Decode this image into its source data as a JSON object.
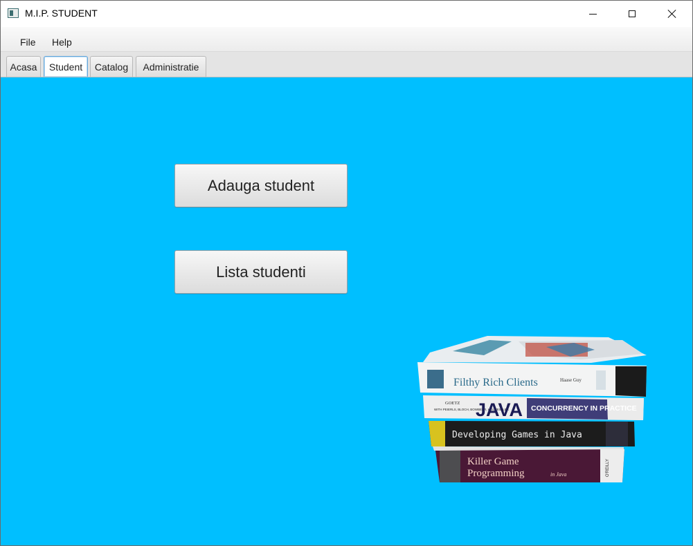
{
  "window": {
    "title": "M.I.P. STUDENT"
  },
  "menu": {
    "items": [
      "File",
      "Help"
    ]
  },
  "tabs": [
    {
      "label": "Acasa",
      "active": false
    },
    {
      "label": "Student",
      "active": true
    },
    {
      "label": "Catalog",
      "active": false
    },
    {
      "label": "Administratie",
      "active": false
    }
  ],
  "content": {
    "background": "#00bfff",
    "buttons": {
      "add_student": "Adauga student",
      "list_students": "Lista studenti"
    }
  },
  "books": [
    {
      "title": "Filthy Rich Clients",
      "authors": "Haase Guy",
      "spine_color": "#f3f4f4"
    },
    {
      "title": "JAVA",
      "subtitle": "CONCURRENCY IN PRACTICE",
      "authors": "GOETZ",
      "author_line": "WITH PEIERLS, BLOCH, BOWBEER, HOLMES, LEA",
      "spine_color": "#eeeeee"
    },
    {
      "title": "Developing Games in Java",
      "spine_color": "#1c1c1c"
    },
    {
      "title": "Killer Game",
      "title_line2": "Programming",
      "suffix": "in Java",
      "publisher": "O'REILLY",
      "spine_color": "#4a1836"
    }
  ]
}
